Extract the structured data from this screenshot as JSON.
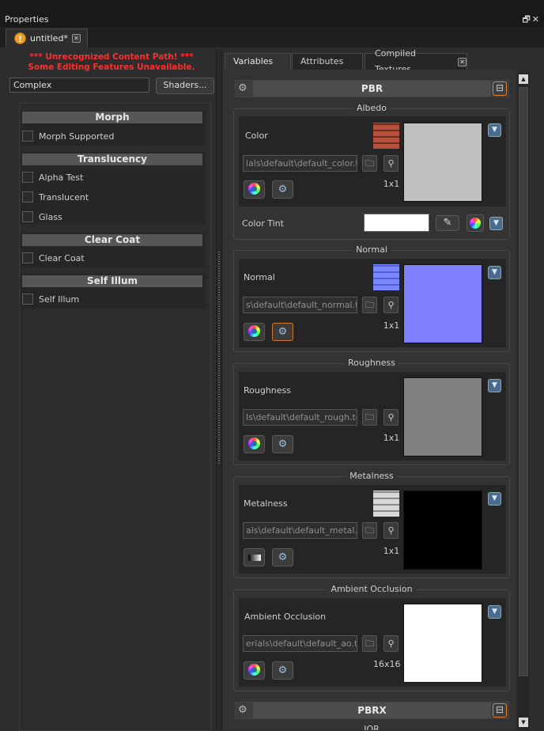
{
  "window": {
    "title": "Properties",
    "doc_tab": "untitled*"
  },
  "left": {
    "error_line1": "*** Unrecognized Content Path! ***",
    "error_line2": "Some Editing Features Unavailable.",
    "shader_field": "Complex",
    "shaders_button": "Shaders...",
    "sections": [
      {
        "title": "Morph",
        "items": [
          "Morph Supported"
        ]
      },
      {
        "title": "Translucency",
        "items": [
          "Alpha Test",
          "Translucent",
          "Glass"
        ]
      },
      {
        "title": "Clear Coat",
        "items": [
          "Clear Coat"
        ]
      },
      {
        "title": "Self Illum",
        "items": [
          "Self Illum"
        ]
      }
    ]
  },
  "tabs": {
    "variables": "Variables",
    "attributes": "Attributes",
    "compiled": "Compiled Textures"
  },
  "pbr": {
    "header": "PBR",
    "albedo": {
      "group": "Albedo",
      "label": "Color",
      "path": "ials\\default\\default_color.tga",
      "size": "1x1",
      "tint_label": "Color Tint",
      "preview_color": "#c0c0c0"
    },
    "normal": {
      "group": "Normal",
      "label": "Normal",
      "path": "s\\default\\default_normal.tga",
      "size": "1x1",
      "preview_color": "#8080ff"
    },
    "roughness": {
      "group": "Roughness",
      "label": "Roughness",
      "path": "ls\\default\\default_rough.tga",
      "size": "1x1",
      "preview_color": "#808080"
    },
    "metalness": {
      "group": "Metalness",
      "label": "Metalness",
      "path": "als\\default\\default_metal.tga",
      "size": "1x1",
      "preview_color": "#000000"
    },
    "ao": {
      "group": "Ambient Occlusion",
      "label": "Ambient Occlusion",
      "path": "erials\\default\\default_ao.tga",
      "size": "16x16",
      "preview_color": "#ffffff"
    }
  },
  "pbrx": {
    "header": "PBRX",
    "next_label": "IOR"
  },
  "icons": {
    "warning": "warning-icon",
    "gear": "gear-icon",
    "folder": "folder-icon",
    "search": "magnifier-icon",
    "eyedropper": "eyedropper-icon",
    "color_wheel": "color-wheel-icon"
  }
}
